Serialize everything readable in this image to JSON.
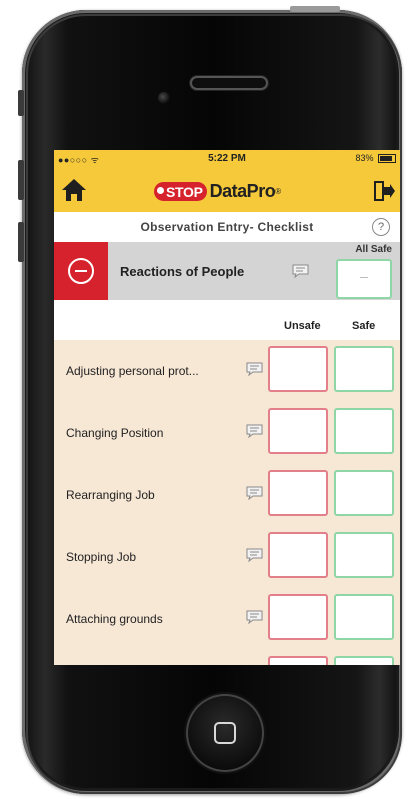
{
  "status_bar": {
    "carrier": "●●○○○ ᯤ",
    "time": "5:22 PM",
    "battery": "83%"
  },
  "app": {
    "logo_stop": "STOP",
    "logo_name": "DataPro",
    "logo_mark": "®"
  },
  "page": {
    "title": "Observation Entry- Checklist",
    "help": "?"
  },
  "section": {
    "title": "Reactions of People",
    "all_safe_label": "All Safe"
  },
  "columns": {
    "unsafe": "Unsafe",
    "safe": "Safe"
  },
  "items": [
    {
      "label": "Adjusting personal prot..."
    },
    {
      "label": "Changing Position"
    },
    {
      "label": "Rearranging Job"
    },
    {
      "label": "Stopping Job"
    },
    {
      "label": "Attaching grounds"
    },
    {
      "label": ""
    }
  ],
  "colors": {
    "brand_yellow": "#f5c93a",
    "brand_red": "#d5222c",
    "unsafe_border": "#e37f8b",
    "safe_border": "#8fd6a7",
    "row_bg": "#f7e7d5"
  }
}
